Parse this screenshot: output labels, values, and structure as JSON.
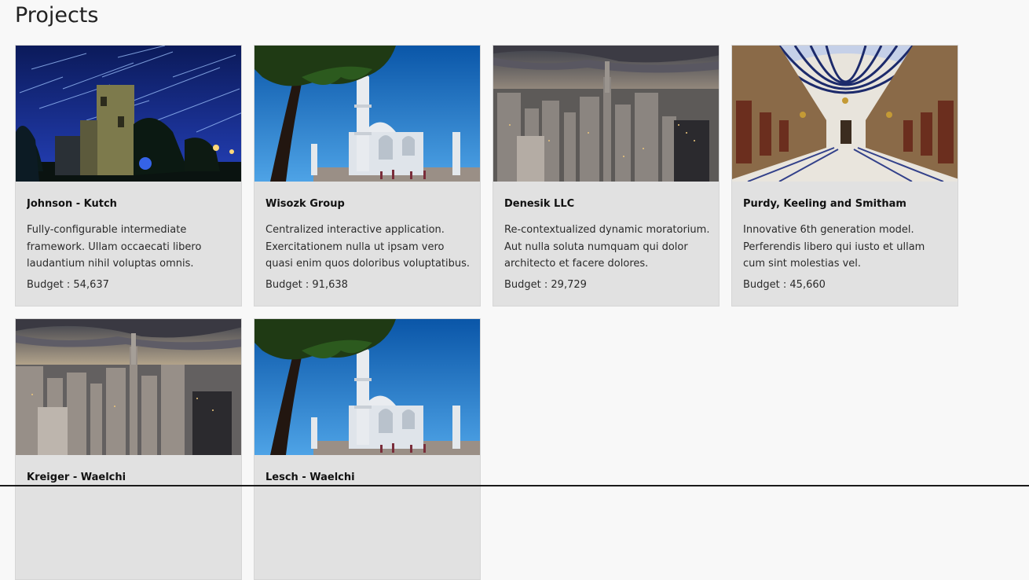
{
  "page": {
    "title": "Projects"
  },
  "projects": [
    {
      "name": "Johnson - Kutch",
      "description": "Fully-configurable intermediate framework. Ullam occaecati libero laudantium nihil voluptas omnis.",
      "budget": "Budget : 54,637",
      "image": "night-ruins-star-trails"
    },
    {
      "name": "Wisozk Group",
      "description": "Centralized interactive application. Exercitationem nulla ut ipsam vero quasi enim quos doloribus voluptatibus.",
      "budget": "Budget : 91,638",
      "image": "taj-mahal-blue-sky"
    },
    {
      "name": "Denesik LLC",
      "description": "Re-contextualized dynamic moratorium. Aut nulla soluta numquam qui dolor architecto et facere dolores.",
      "budget": "Budget : 29,729",
      "image": "city-skyline-dusk"
    },
    {
      "name": "Purdy, Keeling and Smitham",
      "description": "Innovative 6th generation model. Perferendis libero qui iusto et ullam cum sint molestias vel.",
      "budget": "Budget : 45,660",
      "image": "arched-glass-arcade"
    },
    {
      "name": "Kreiger - Waelchi",
      "description": "",
      "budget": "",
      "image": "city-skyline-dusk"
    },
    {
      "name": "Lesch - Waelchi",
      "description": "",
      "budget": "",
      "image": "taj-mahal-blue-sky"
    }
  ]
}
